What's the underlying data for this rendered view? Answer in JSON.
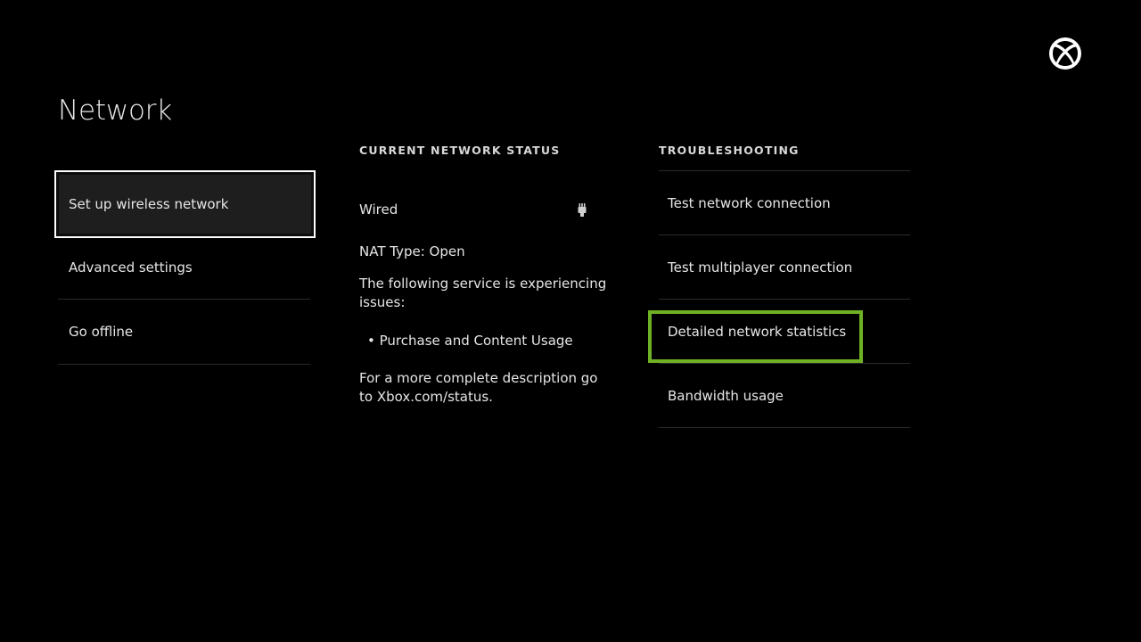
{
  "page": {
    "title": "Network"
  },
  "left_menu": {
    "items": [
      {
        "label": "Set up wireless network",
        "focused": true
      },
      {
        "label": "Advanced settings"
      },
      {
        "label": "Go offline"
      }
    ]
  },
  "status": {
    "header": "CURRENT NETWORK STATUS",
    "connection": "Wired",
    "connection_icon": "ethernet-plug-icon",
    "nat": "NAT Type: Open",
    "issue_intro": "The following service is experiencing issues:",
    "issue_item": "• Purchase and Content Usage",
    "more_info": "For a more complete description go to Xbox.com/status."
  },
  "troubleshooting": {
    "header": "TROUBLESHOOTING",
    "items": [
      {
        "label": "Test network connection"
      },
      {
        "label": "Test multiplayer connection"
      },
      {
        "label": "Detailed network statistics",
        "highlighted": true
      },
      {
        "label": "Bandwidth usage"
      }
    ]
  },
  "colors": {
    "background": "#000000",
    "focus_border": "#ffffff",
    "highlight": "#6fb124",
    "divider": "#2a2a2a"
  },
  "icons": {
    "logo": "xbox-logo-icon"
  }
}
